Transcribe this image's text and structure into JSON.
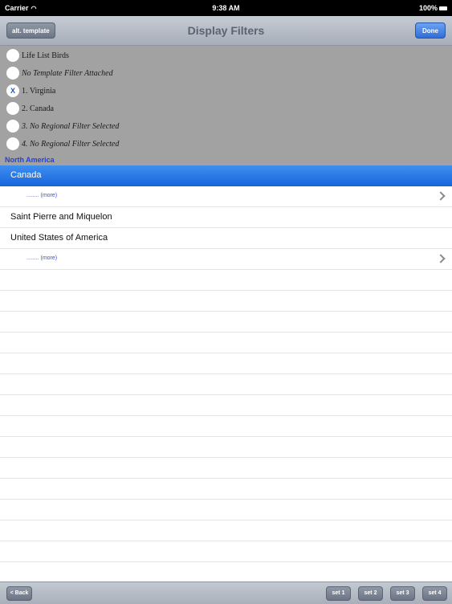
{
  "status_bar": {
    "carrier": "Carrier",
    "time": "9:38 AM",
    "battery": "100%"
  },
  "nav": {
    "left_button": "alt. template",
    "title": "Display Filters",
    "right_button": "Done"
  },
  "filters": [
    {
      "label": "Life List Birds",
      "checked": false,
      "italic": false
    },
    {
      "label": "No Template Filter Attached",
      "checked": false,
      "italic": true
    },
    {
      "label": "1. Virginia",
      "checked": true,
      "mark": "X",
      "italic": false
    },
    {
      "label": "2. Canada",
      "checked": false,
      "italic": false
    },
    {
      "label": "3. No Regional Filter Selected",
      "checked": false,
      "italic": true
    },
    {
      "label": "4. No Regional Filter Selected",
      "checked": false,
      "italic": true
    }
  ],
  "region_label": "North America",
  "list": {
    "rows": [
      {
        "label": "Canada",
        "selected": true
      },
      {
        "more": "........ (more)"
      },
      {
        "label": "Saint Pierre and Miquelon"
      },
      {
        "label": "United States of America"
      },
      {
        "more": "........ (more)"
      }
    ]
  },
  "toolbar": {
    "back": "< Back",
    "set_buttons": [
      "set 1",
      "set 2",
      "set 3",
      "set 4"
    ]
  }
}
